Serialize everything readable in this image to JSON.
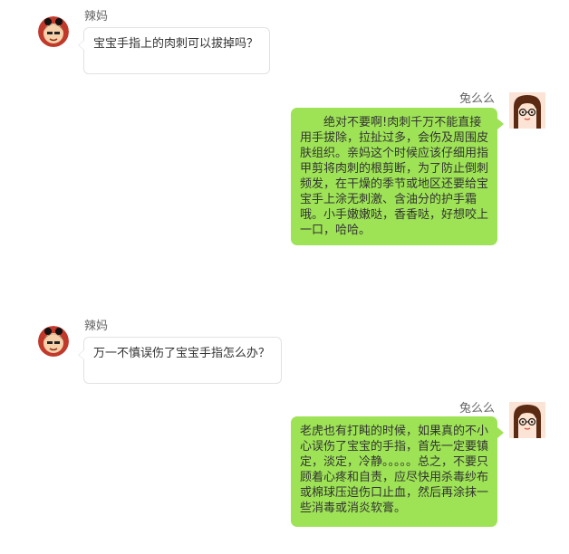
{
  "messages": [
    {
      "side": "left",
      "sender": "辣妈",
      "text": "宝宝手指上的肉刺可以拔掉吗？",
      "avatar_icon": "mom-cartoon-avatar-icon"
    },
    {
      "side": "right",
      "sender": "兔么么",
      "text": "绝对不要啊!肉刺千万不能直接用手拔除，拉扯过多，会伤及周围皮肤组织。亲妈这个时候应该仔细用指甲剪将肉刺的根剪断，为了防止倒刺频发，在干燥的季节或地区还要给宝宝手上涂无刺激、含油分的护手霜哦。小手嫩嫩哒，香香哒，好想咬上一口，哈哈。",
      "avatar_icon": "girl-glasses-avatar-icon"
    },
    {
      "side": "left",
      "sender": "辣妈",
      "text": "万一不慎误伤了宝宝手指怎么办？",
      "avatar_icon": "mom-cartoon-avatar-icon"
    },
    {
      "side": "right",
      "sender": "兔么么",
      "text": "老虎也有打盹的时候，如果真的不小心误伤了宝宝的手指，首先一定要镇定，淡定，冷静。。。。。总之，不要只顾着心疼和自责，应尽快用杀毒纱布或棉球压迫伤口止血，然后再涂抹一些消毒或消炎软膏。",
      "avatar_icon": "girl-glasses-avatar-icon"
    }
  ],
  "colors": {
    "right_bubble": "#9ee356",
    "left_bubble_border": "#e2e2e2",
    "sender_text": "#666666",
    "message_text": "#333333"
  }
}
